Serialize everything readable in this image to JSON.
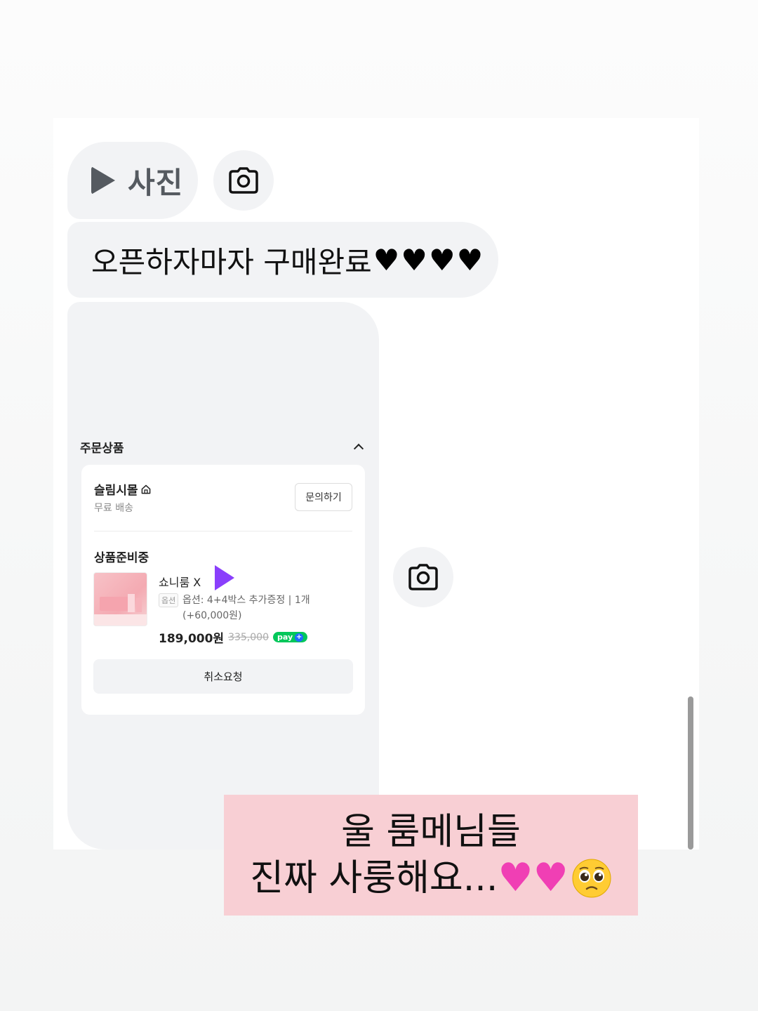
{
  "photo_chip": {
    "label": "사진",
    "icon": "play-icon"
  },
  "message": {
    "text": "오픈하자마자 구매완료",
    "hearts": "♥♥♥♥"
  },
  "order": {
    "section_title": "주문상품",
    "store_name": "슬림시몰",
    "shipping": "무료 배송",
    "inquiry_button": "문의하기",
    "status": "상품준비중",
    "product_name": "쇼니룸 X",
    "option_badge": "옵션",
    "option_text": "옵션: 4+4박스 추가증정 | 1개 (+60,000원)",
    "price": "189,000원",
    "original_price": "335,000",
    "npay_label": "pay",
    "cancel_button": "취소요청"
  },
  "caption": {
    "line1": "울 룸메님들",
    "line2": "진짜 사룽해요...",
    "emoji_hearts": "♥♥",
    "emoji_face": "pleading-face-emoji"
  },
  "colors": {
    "caption_bg": "#f8cfd4",
    "bubble_bg": "#f2f3f5",
    "npay_green": "#03c75a",
    "play_purple": "#8a3ffc",
    "pink_heart": "#f03fb4"
  }
}
